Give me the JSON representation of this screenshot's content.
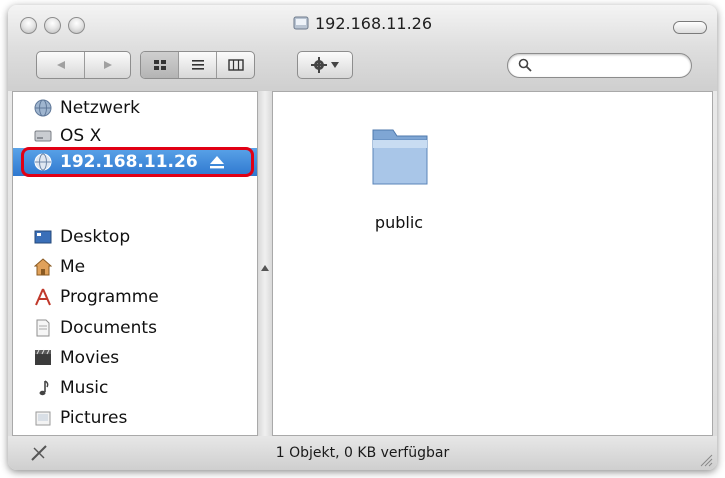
{
  "window": {
    "title": "192.168.11.26"
  },
  "toolbar": {
    "back_icon": "back-arrow-icon",
    "forward_icon": "forward-arrow-icon",
    "view_icons": [
      "icon-view-icon",
      "list-view-icon",
      "column-view-icon"
    ],
    "action_icon": "gear-icon",
    "search_icon": "magnifier-icon"
  },
  "sidebar": {
    "devices": [
      {
        "label": "Netzwerk",
        "icon": "network-globe-icon"
      },
      {
        "label": "OS X",
        "icon": "hard-disk-icon"
      },
      {
        "label": "192.168.11.26",
        "icon": "server-icon",
        "selected": true,
        "eject_icon": "eject-icon"
      }
    ],
    "places": [
      {
        "label": "Desktop",
        "icon": "desktop-icon"
      },
      {
        "label": "Me",
        "icon": "home-icon"
      },
      {
        "label": "Programme",
        "icon": "applications-icon"
      },
      {
        "label": "Documents",
        "icon": "documents-icon"
      },
      {
        "label": "Movies",
        "icon": "movies-icon"
      },
      {
        "label": "Music",
        "icon": "music-icon"
      },
      {
        "label": "Pictures",
        "icon": "pictures-icon"
      }
    ]
  },
  "main": {
    "items": [
      {
        "label": "public",
        "icon": "folder-icon"
      }
    ]
  },
  "status": {
    "text": "1 Objekt,   0 KB verfügbar"
  },
  "colors": {
    "selection": "#2f78cf",
    "highlight_border": "#e10014"
  }
}
